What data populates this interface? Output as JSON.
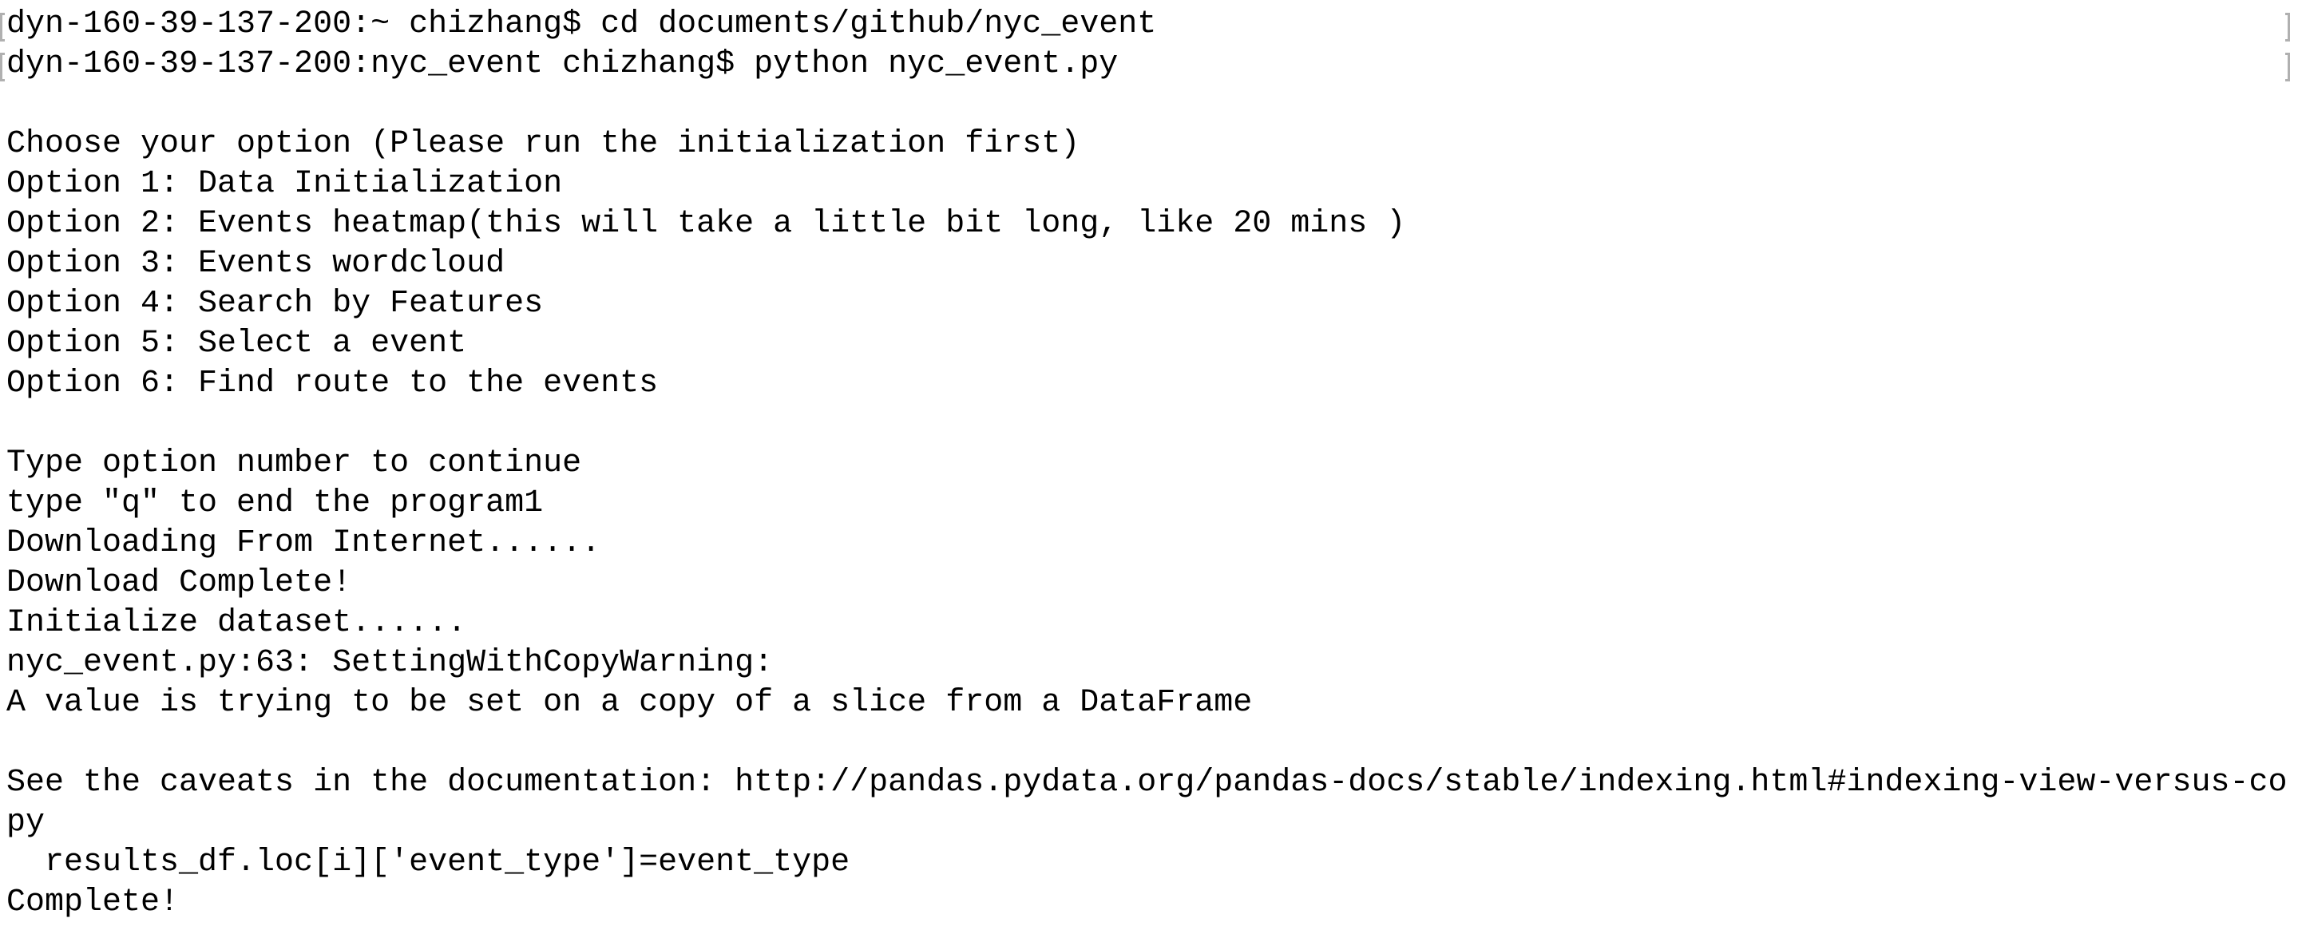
{
  "terminal": {
    "lines": [
      "dyn-160-39-137-200:~ chizhang$ cd documents/github/nyc_event",
      "dyn-160-39-137-200:nyc_event chizhang$ python nyc_event.py",
      "",
      "Choose your option (Please run the initialization first)",
      "Option 1: Data Initialization",
      "Option 2: Events heatmap(this will take a little bit long, like 20 mins )",
      "Option 3: Events wordcloud",
      "Option 4: Search by Features",
      "Option 5: Select a event",
      "Option 6: Find route to the events",
      "",
      "Type option number to continue",
      "type \"q\" to end the program1",
      "Downloading From Internet......",
      "Download Complete!",
      "Initialize dataset......",
      "nyc_event.py:63: SettingWithCopyWarning:",
      "A value is trying to be set on a copy of a slice from a DataFrame",
      "",
      "See the caveats in the documentation: http://pandas.pydata.org/pandas-docs/stable/indexing.html#indexing-view-versus-co",
      "py",
      "  results_df.loc[i]['event_type']=event_type",
      "Complete!"
    ]
  }
}
